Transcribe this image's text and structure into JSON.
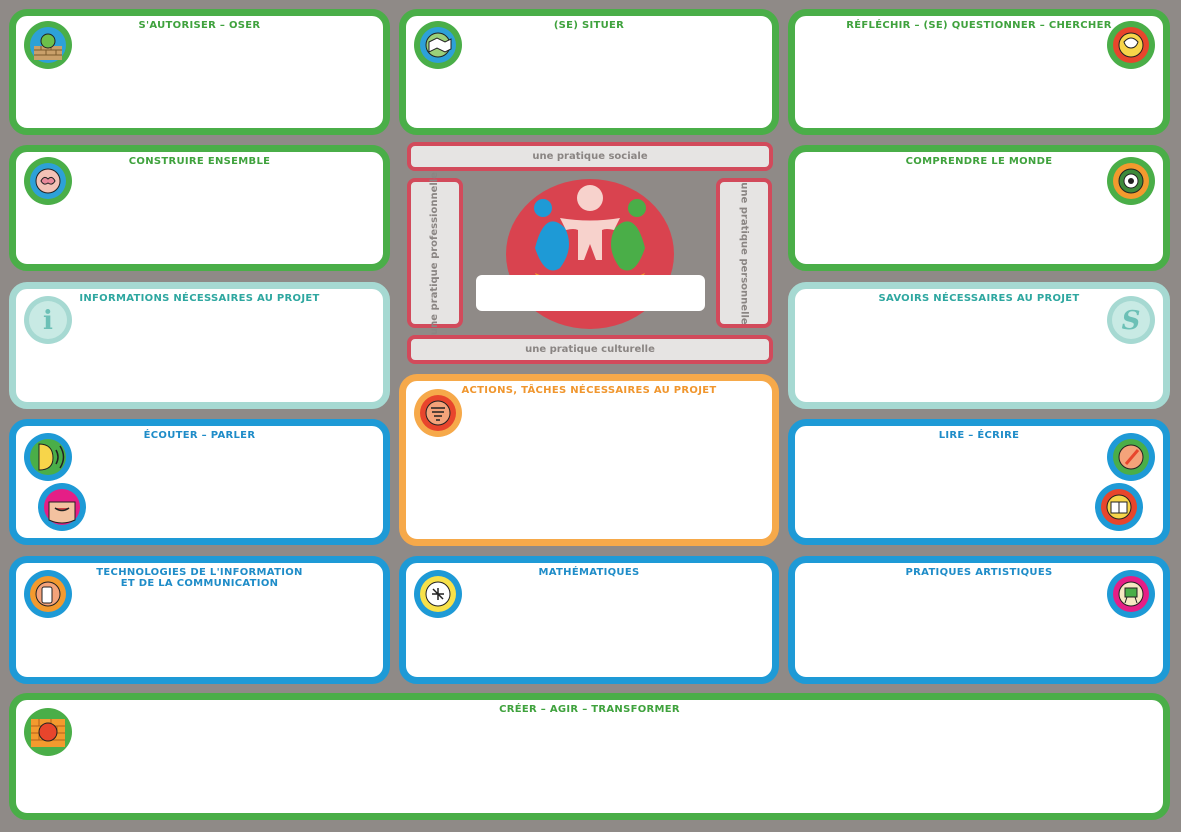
{
  "cards": {
    "autoriser": "S'AUTORISER – OSER",
    "situer": "(SE) SITUER",
    "reflechir": "RÉFLÉCHIR – (SE) QUESTIONNER – CHERCHER",
    "construire": "CONSTRUIRE ENSEMBLE",
    "comprendre": "COMPRENDRE LE MONDE",
    "informations": "INFORMATIONS NÉCESSAIRES AU PROJET",
    "savoirs": "SAVOIRS NÉCESSAIRES AU PROJET",
    "ecouter": "ÉCOUTER – PARLER",
    "actions": "ACTIONS, TÂCHES NÉCESSAIRES AU PROJET",
    "lire": "LIRE – ÉCRIRE",
    "tic_line1": "TECHNOLOGIES DE L'INFORMATION",
    "tic_line2": "ET DE LA COMMUNICATION",
    "maths": "MATHÉMATIQUES",
    "arts": "PRATIQUES ARTISTIQUES",
    "creer": "CRÉER – AGIR – TRANSFORMER"
  },
  "center": {
    "sociale": "une pratique sociale",
    "culturelle": "une pratique culturelle",
    "professionnelle": "une pratique professionnelle",
    "personnelle": "une pratique personnelle",
    "name_field": ""
  },
  "icons": {
    "info_letter": "i",
    "savoirs_letter": "S"
  },
  "colors": {
    "green": "#4aae48",
    "teal": "#a6d9d2",
    "blue": "#1e9ad6",
    "orange": "#f6a94a",
    "red": "#d24a5b",
    "background": "#8f8a87"
  }
}
